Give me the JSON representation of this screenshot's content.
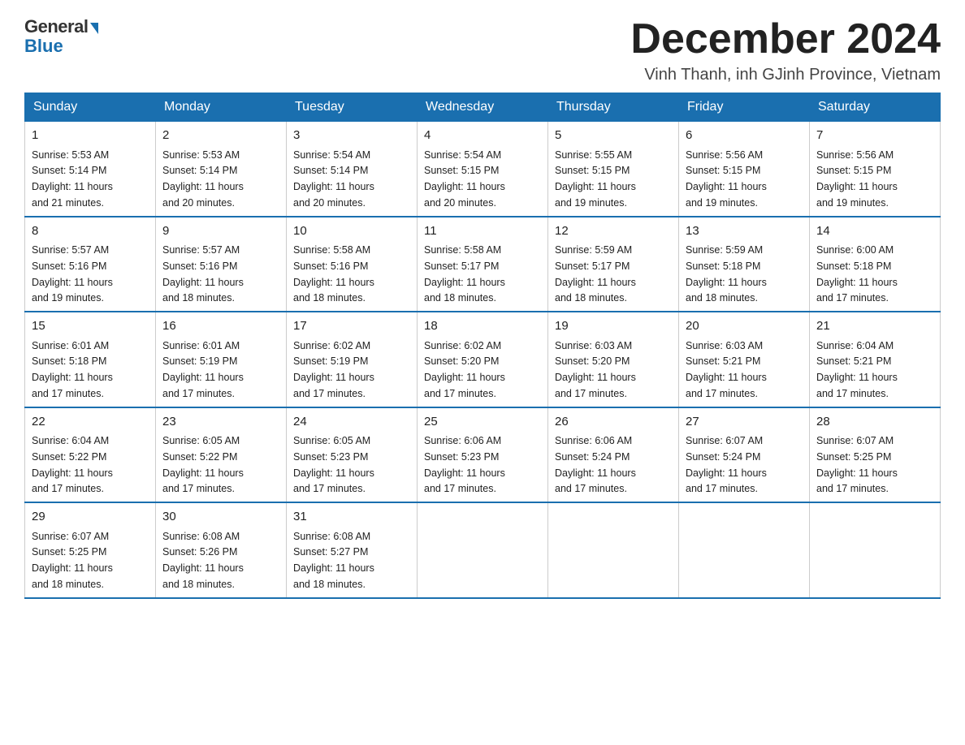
{
  "logo": {
    "general": "General",
    "blue": "Blue"
  },
  "title": "December 2024",
  "location": "Vinh Thanh, inh GJinh Province, Vietnam",
  "days_of_week": [
    "Sunday",
    "Monday",
    "Tuesday",
    "Wednesday",
    "Thursday",
    "Friday",
    "Saturday"
  ],
  "weeks": [
    [
      {
        "day": "1",
        "sunrise": "5:53 AM",
        "sunset": "5:14 PM",
        "daylight": "11 hours and 21 minutes."
      },
      {
        "day": "2",
        "sunrise": "5:53 AM",
        "sunset": "5:14 PM",
        "daylight": "11 hours and 20 minutes."
      },
      {
        "day": "3",
        "sunrise": "5:54 AM",
        "sunset": "5:14 PM",
        "daylight": "11 hours and 20 minutes."
      },
      {
        "day": "4",
        "sunrise": "5:54 AM",
        "sunset": "5:15 PM",
        "daylight": "11 hours and 20 minutes."
      },
      {
        "day": "5",
        "sunrise": "5:55 AM",
        "sunset": "5:15 PM",
        "daylight": "11 hours and 19 minutes."
      },
      {
        "day": "6",
        "sunrise": "5:56 AM",
        "sunset": "5:15 PM",
        "daylight": "11 hours and 19 minutes."
      },
      {
        "day": "7",
        "sunrise": "5:56 AM",
        "sunset": "5:15 PM",
        "daylight": "11 hours and 19 minutes."
      }
    ],
    [
      {
        "day": "8",
        "sunrise": "5:57 AM",
        "sunset": "5:16 PM",
        "daylight": "11 hours and 19 minutes."
      },
      {
        "day": "9",
        "sunrise": "5:57 AM",
        "sunset": "5:16 PM",
        "daylight": "11 hours and 18 minutes."
      },
      {
        "day": "10",
        "sunrise": "5:58 AM",
        "sunset": "5:16 PM",
        "daylight": "11 hours and 18 minutes."
      },
      {
        "day": "11",
        "sunrise": "5:58 AM",
        "sunset": "5:17 PM",
        "daylight": "11 hours and 18 minutes."
      },
      {
        "day": "12",
        "sunrise": "5:59 AM",
        "sunset": "5:17 PM",
        "daylight": "11 hours and 18 minutes."
      },
      {
        "day": "13",
        "sunrise": "5:59 AM",
        "sunset": "5:18 PM",
        "daylight": "11 hours and 18 minutes."
      },
      {
        "day": "14",
        "sunrise": "6:00 AM",
        "sunset": "5:18 PM",
        "daylight": "11 hours and 17 minutes."
      }
    ],
    [
      {
        "day": "15",
        "sunrise": "6:01 AM",
        "sunset": "5:18 PM",
        "daylight": "11 hours and 17 minutes."
      },
      {
        "day": "16",
        "sunrise": "6:01 AM",
        "sunset": "5:19 PM",
        "daylight": "11 hours and 17 minutes."
      },
      {
        "day": "17",
        "sunrise": "6:02 AM",
        "sunset": "5:19 PM",
        "daylight": "11 hours and 17 minutes."
      },
      {
        "day": "18",
        "sunrise": "6:02 AM",
        "sunset": "5:20 PM",
        "daylight": "11 hours and 17 minutes."
      },
      {
        "day": "19",
        "sunrise": "6:03 AM",
        "sunset": "5:20 PM",
        "daylight": "11 hours and 17 minutes."
      },
      {
        "day": "20",
        "sunrise": "6:03 AM",
        "sunset": "5:21 PM",
        "daylight": "11 hours and 17 minutes."
      },
      {
        "day": "21",
        "sunrise": "6:04 AM",
        "sunset": "5:21 PM",
        "daylight": "11 hours and 17 minutes."
      }
    ],
    [
      {
        "day": "22",
        "sunrise": "6:04 AM",
        "sunset": "5:22 PM",
        "daylight": "11 hours and 17 minutes."
      },
      {
        "day": "23",
        "sunrise": "6:05 AM",
        "sunset": "5:22 PM",
        "daylight": "11 hours and 17 minutes."
      },
      {
        "day": "24",
        "sunrise": "6:05 AM",
        "sunset": "5:23 PM",
        "daylight": "11 hours and 17 minutes."
      },
      {
        "day": "25",
        "sunrise": "6:06 AM",
        "sunset": "5:23 PM",
        "daylight": "11 hours and 17 minutes."
      },
      {
        "day": "26",
        "sunrise": "6:06 AM",
        "sunset": "5:24 PM",
        "daylight": "11 hours and 17 minutes."
      },
      {
        "day": "27",
        "sunrise": "6:07 AM",
        "sunset": "5:24 PM",
        "daylight": "11 hours and 17 minutes."
      },
      {
        "day": "28",
        "sunrise": "6:07 AM",
        "sunset": "5:25 PM",
        "daylight": "11 hours and 17 minutes."
      }
    ],
    [
      {
        "day": "29",
        "sunrise": "6:07 AM",
        "sunset": "5:25 PM",
        "daylight": "11 hours and 18 minutes."
      },
      {
        "day": "30",
        "sunrise": "6:08 AM",
        "sunset": "5:26 PM",
        "daylight": "11 hours and 18 minutes."
      },
      {
        "day": "31",
        "sunrise": "6:08 AM",
        "sunset": "5:27 PM",
        "daylight": "11 hours and 18 minutes."
      },
      null,
      null,
      null,
      null
    ]
  ],
  "labels": {
    "sunrise": "Sunrise:",
    "sunset": "Sunset:",
    "daylight": "Daylight:"
  }
}
